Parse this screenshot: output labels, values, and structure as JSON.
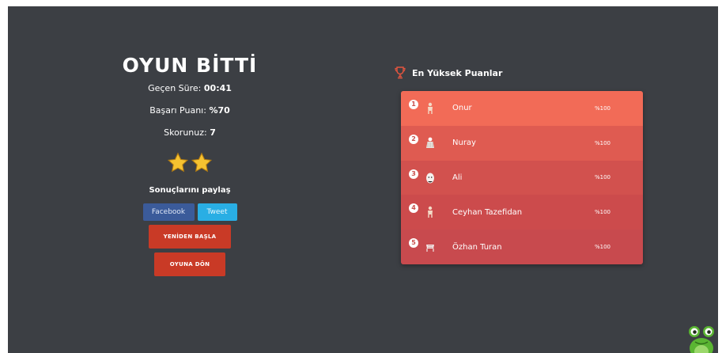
{
  "result": {
    "title": "OYUN BİTTİ",
    "elapsed_label": "Geçen Süre:",
    "elapsed_value": "00:41",
    "success_label": "Başarı Puanı:",
    "success_value": "%70",
    "score_label": "Skorunuz:",
    "score_value": "7",
    "stars_earned": 2
  },
  "share": {
    "title": "Sonuçlarını paylaş",
    "facebook_label": "Facebook",
    "tweet_label": "Tweet"
  },
  "actions": {
    "restart_label": "YENİDEN BAŞLA",
    "back_label": "OYUNA DÖN"
  },
  "scores": {
    "title": "En Yüksek Puanlar",
    "title_icon": "trophy-icon",
    "rows": [
      {
        "rank": "1",
        "name": "Onur",
        "percent": "%100",
        "avatar": "person-icon",
        "color": "#f26b57"
      },
      {
        "rank": "2",
        "name": "Nuray",
        "percent": "%100",
        "avatar": "woman-icon",
        "color": "#df5b51"
      },
      {
        "rank": "3",
        "name": "Ali",
        "percent": "%100",
        "avatar": "child-icon",
        "color": "#d2514e"
      },
      {
        "rank": "4",
        "name": "Ceyhan Tazefidan",
        "percent": "%100",
        "avatar": "person-icon",
        "color": "#cc4b4c"
      },
      {
        "rank": "5",
        "name": "Özhan Turan",
        "percent": "%100",
        "avatar": "cart-icon",
        "color": "#c84a4e"
      }
    ]
  },
  "colors": {
    "background": "#3c3f44",
    "accent_red": "#c93a26",
    "facebook": "#3b5b9a",
    "twitter": "#29aee4",
    "star": "#f5c230"
  },
  "mascot": "frog-icon"
}
